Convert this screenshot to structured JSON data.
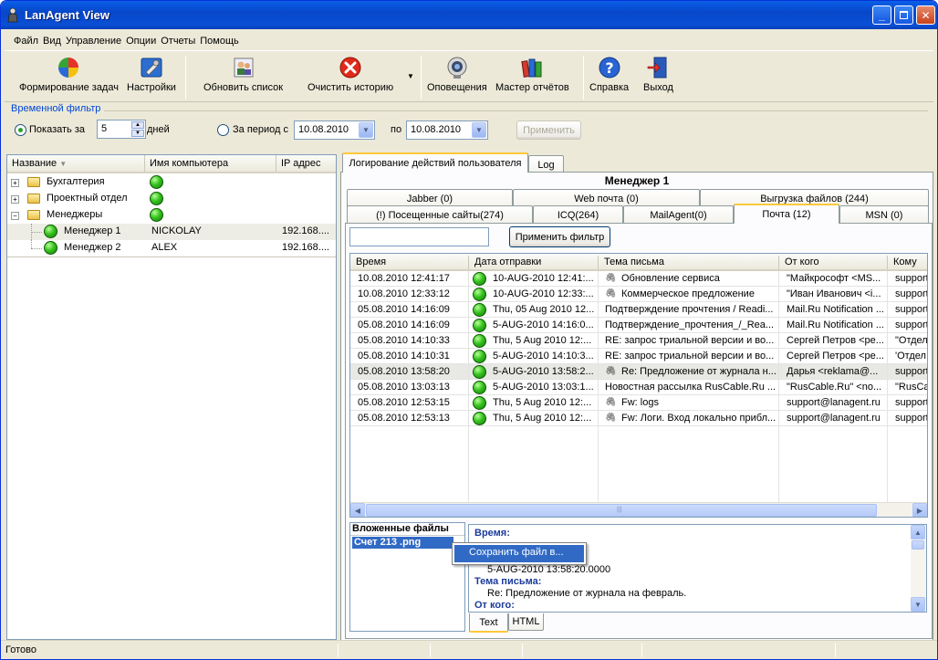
{
  "window": {
    "title": "LanAgent View"
  },
  "menu": [
    "Файл",
    "Вид",
    "Управление",
    "Опции",
    "Отчеты",
    "Помощь"
  ],
  "toolbar": {
    "task": "Формирование задач",
    "settings": "Настройки",
    "refresh": "Обновить список",
    "clear": "Очистить историю",
    "alerts": "Оповещения",
    "reports": "Мастер отчётов",
    "help": "Справка",
    "exit": "Выход"
  },
  "filter": {
    "group_label": "Временной фильтр",
    "show_for": "Показать за",
    "days_value": "5",
    "days": "дней",
    "period_from": "За период с",
    "date_from": "10.08.2010",
    "to": "по",
    "date_to": "10.08.2010",
    "apply": "Применить"
  },
  "tree": {
    "headers": [
      "Название",
      "Имя компьютера",
      "IP адрес"
    ],
    "rows": [
      {
        "name": "Бухгалтерия",
        "computer": "",
        "ip": ""
      },
      {
        "name": "Проектный отдел",
        "computer": "",
        "ip": ""
      },
      {
        "name": "Менеджеры",
        "computer": "",
        "ip": ""
      },
      {
        "name": "Менеджер 1",
        "computer": "NICKOLAY",
        "ip": "192.168...."
      },
      {
        "name": "Менеджер 2",
        "computer": "ALEX",
        "ip": "192.168...."
      }
    ]
  },
  "tabs_top": [
    "Логирование действий пользователя",
    "Log"
  ],
  "user_title": "Менеджер 1",
  "tabs_row1": [
    "Jabber (0)",
    "Web почта (0)",
    "Выгрузка файлов (244)"
  ],
  "tabs_row2": [
    "(!) Посещенные сайты(274)",
    "ICQ(264)",
    "MailAgent(0)",
    "Почта (12)",
    "MSN (0)"
  ],
  "mail": {
    "apply_filter": "Применить фильтр",
    "headers": [
      "Время",
      "Дата отправки",
      "Тема письма",
      "От кого",
      "Кому"
    ],
    "rows": [
      {
        "time": "10.08.2010 12:41:17",
        "sent": "10-AUG-2010 12:41:...",
        "subject": "Обновление сервиса",
        "from": "\"Майкрософт <MS...",
        "to": "support",
        "clip": true
      },
      {
        "time": "10.08.2010 12:33:12",
        "sent": "10-AUG-2010 12:33:...",
        "subject": "Коммерческое предложение",
        "from": "\"Иван Иванович <i...",
        "to": "support",
        "clip": true
      },
      {
        "time": "05.08.2010 14:16:09",
        "sent": "Thu, 05 Aug 2010 12...",
        "subject": "Подтверждение прочтения / Readi...",
        "from": "Mail.Ru Notification ...",
        "to": "support",
        "clip": false
      },
      {
        "time": "05.08.2010 14:16:09",
        "sent": "5-AUG-2010 14:16:0...",
        "subject": "Подтверждение_прочтения_/_Rea...",
        "from": "Mail.Ru Notification ...",
        "to": "support",
        "clip": false
      },
      {
        "time": "05.08.2010 14:10:33",
        "sent": "Thu, 5 Aug 2010 12:...",
        "subject": "RE: запрос триальной версии и во...",
        "from": "Сергей Петров <ре...",
        "to": "\"Отдел",
        "clip": false
      },
      {
        "time": "05.08.2010 14:10:31",
        "sent": "5-AUG-2010 14:10:3...",
        "subject": "RE: запрос триальной версии и во...",
        "from": "Сергей Петров <ре...",
        "to": "'Отдел",
        "clip": false
      },
      {
        "time": "05.08.2010 13:58:20",
        "sent": "5-AUG-2010 13:58:2...",
        "subject": "Re: Предложение от журнала н...",
        "from": "Дарья <reklama@...",
        "to": "support",
        "clip": true
      },
      {
        "time": "05.08.2010 13:03:13",
        "sent": "5-AUG-2010 13:03:1...",
        "subject": "Новостная рассылка RusCable.Ru ...",
        "from": "\"RusCable.Ru\" <no...",
        "to": "\"RusCa",
        "clip": false
      },
      {
        "time": "05.08.2010 12:53:15",
        "sent": "Thu, 5 Aug 2010 12:...",
        "subject": "Fw: logs",
        "from": "support@lanagent.ru",
        "to": "support",
        "clip": true
      },
      {
        "time": "05.08.2010 12:53:13",
        "sent": "Thu, 5 Aug 2010 12:...",
        "subject": "Fw: Логи. Вход локально прибл...",
        "from": "support@lanagent.ru",
        "to": "support",
        "clip": true
      }
    ],
    "selected_index": 6
  },
  "attachments": {
    "title": "Вложенные файлы",
    "file": "Счет 213 .png"
  },
  "context_menu": {
    "save": "Сохранить файл в..."
  },
  "details": {
    "time_label": "Время:",
    "sent_value": "5-AUG-2010 13:58:20.0000",
    "subject_label": "Тема письма:",
    "subject_value": "Re: Предложение от журнала на февраль.",
    "from_label": "От кого:"
  },
  "detail_tabs": [
    "Text",
    "HTML"
  ],
  "status": {
    "text": "Готово"
  },
  "colors": {
    "accent": "#0a5fe8",
    "selection": "#316ac5",
    "tab_highlight": "#ffc83c"
  }
}
